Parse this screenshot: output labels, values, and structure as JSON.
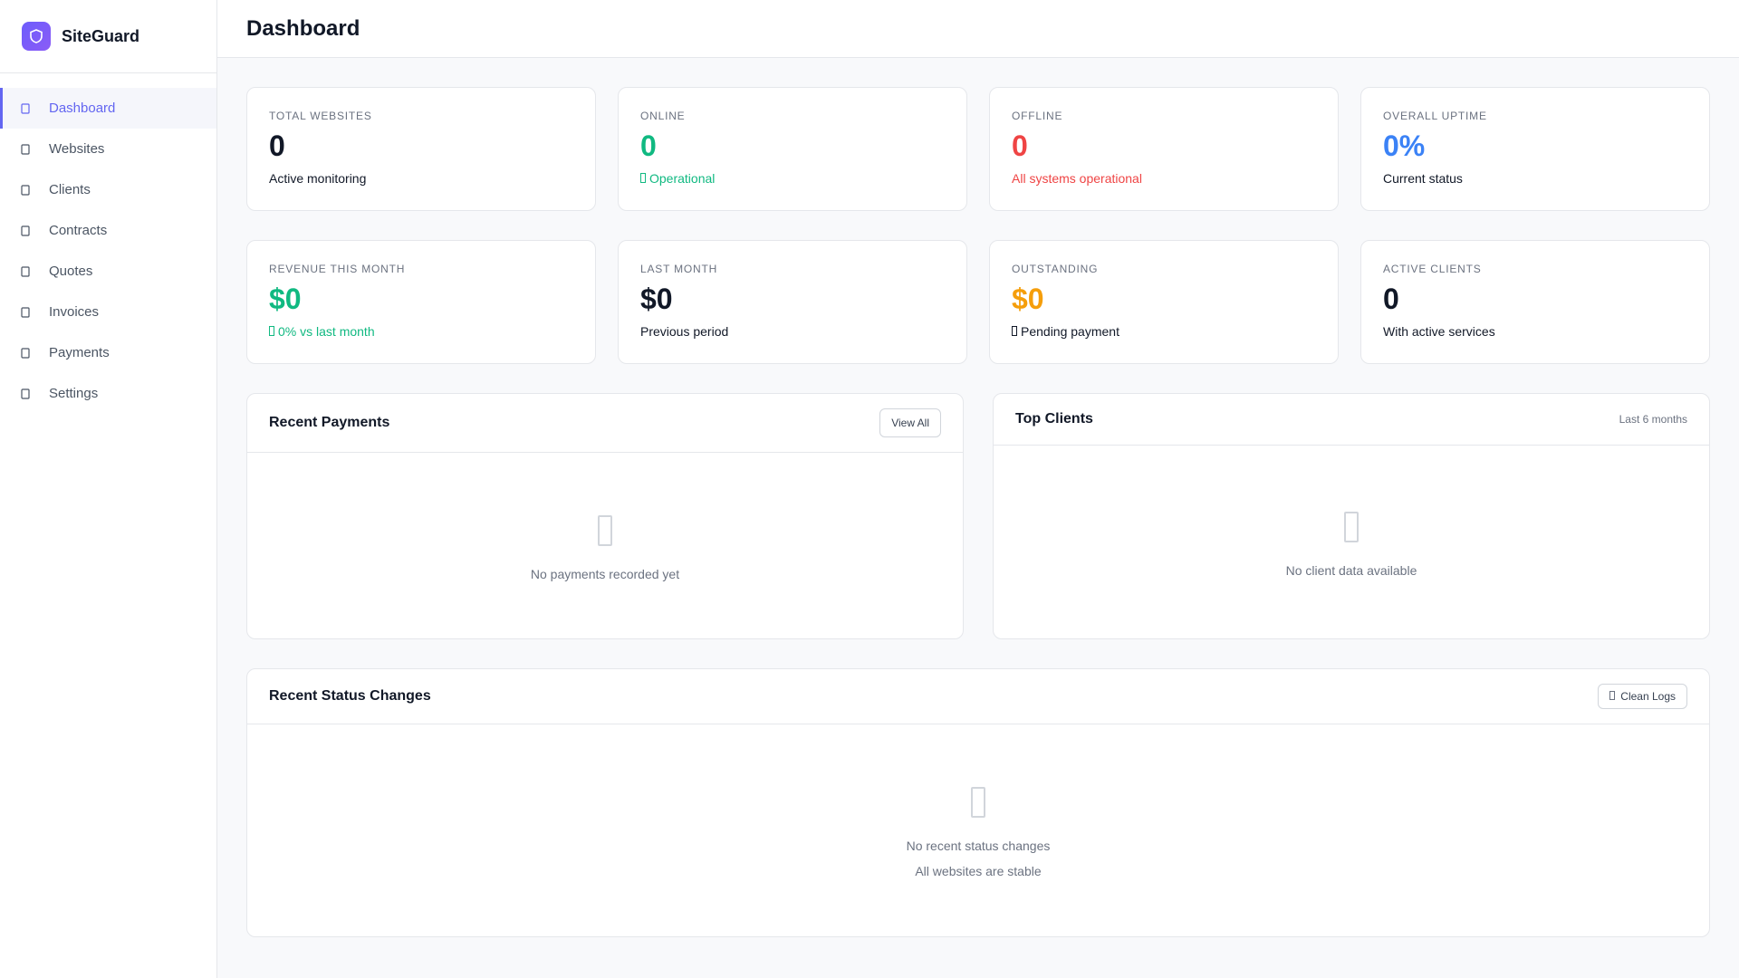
{
  "app": {
    "name": "SiteGuard",
    "logo_icon": "shield-icon"
  },
  "sidebar": {
    "items": [
      {
        "label": "Dashboard",
        "icon": "dashboard-icon",
        "active": true
      },
      {
        "label": "Websites",
        "icon": "globe-icon"
      },
      {
        "label": "Clients",
        "icon": "users-icon"
      },
      {
        "label": "Contracts",
        "icon": "file-contract-icon"
      },
      {
        "label": "Quotes",
        "icon": "quote-icon"
      },
      {
        "label": "Invoices",
        "icon": "invoice-icon"
      },
      {
        "label": "Payments",
        "icon": "credit-card-icon"
      },
      {
        "label": "Settings",
        "icon": "gear-icon"
      }
    ]
  },
  "header": {
    "title": "Dashboard"
  },
  "stats_row_1": [
    {
      "label": "TOTAL WEBSITES",
      "value": "0",
      "sub": "Active monitoring",
      "value_color": "#111827",
      "sub_color": "#111827"
    },
    {
      "label": "ONLINE",
      "value": "0",
      "sub": "Operational",
      "sub_icon": "check-circle-icon",
      "value_color": "#10b981",
      "sub_color": "#10b981"
    },
    {
      "label": "OFFLINE",
      "value": "0",
      "sub": "All systems operational",
      "value_color": "#ef4444",
      "sub_color": "#ef4444"
    },
    {
      "label": "OVERALL UPTIME",
      "value": "0%",
      "sub": "Current status",
      "value_color": "#3b82f6",
      "sub_color": "#111827"
    }
  ],
  "stats_row_2": [
    {
      "label": "REVENUE THIS MONTH",
      "value": "$0",
      "sub": "0% vs last month",
      "sub_icon": "arrow-up-icon",
      "value_color": "#10b981",
      "sub_color": "#10b981"
    },
    {
      "label": "LAST MONTH",
      "value": "$0",
      "sub": "Previous period",
      "value_color": "#111827",
      "sub_color": "#111827"
    },
    {
      "label": "OUTSTANDING",
      "value": "$0",
      "sub": "Pending payment",
      "sub_icon": "clock-icon",
      "value_color": "#f59e0b",
      "sub_color": "#111827"
    },
    {
      "label": "ACTIVE CLIENTS",
      "value": "0",
      "sub": "With active services",
      "value_color": "#111827",
      "sub_color": "#111827"
    }
  ],
  "recent_payments": {
    "title": "Recent Payments",
    "button": "View All",
    "empty_icon": "receipt-icon",
    "empty_text": "No payments recorded yet"
  },
  "top_clients": {
    "title": "Top Clients",
    "meta": "Last 6 months",
    "empty_icon": "users-icon",
    "empty_text": "No client data available"
  },
  "status_changes": {
    "title": "Recent Status Changes",
    "button": "Clean Logs",
    "button_icon": "broom-icon",
    "empty_icon": "history-icon",
    "empty_text": "No recent status changes",
    "empty_subtext": "All websites are stable"
  },
  "colors": {
    "accent": "#6366f1",
    "success": "#10b981",
    "danger": "#ef4444",
    "info": "#3b82f6",
    "warning": "#f59e0b"
  }
}
